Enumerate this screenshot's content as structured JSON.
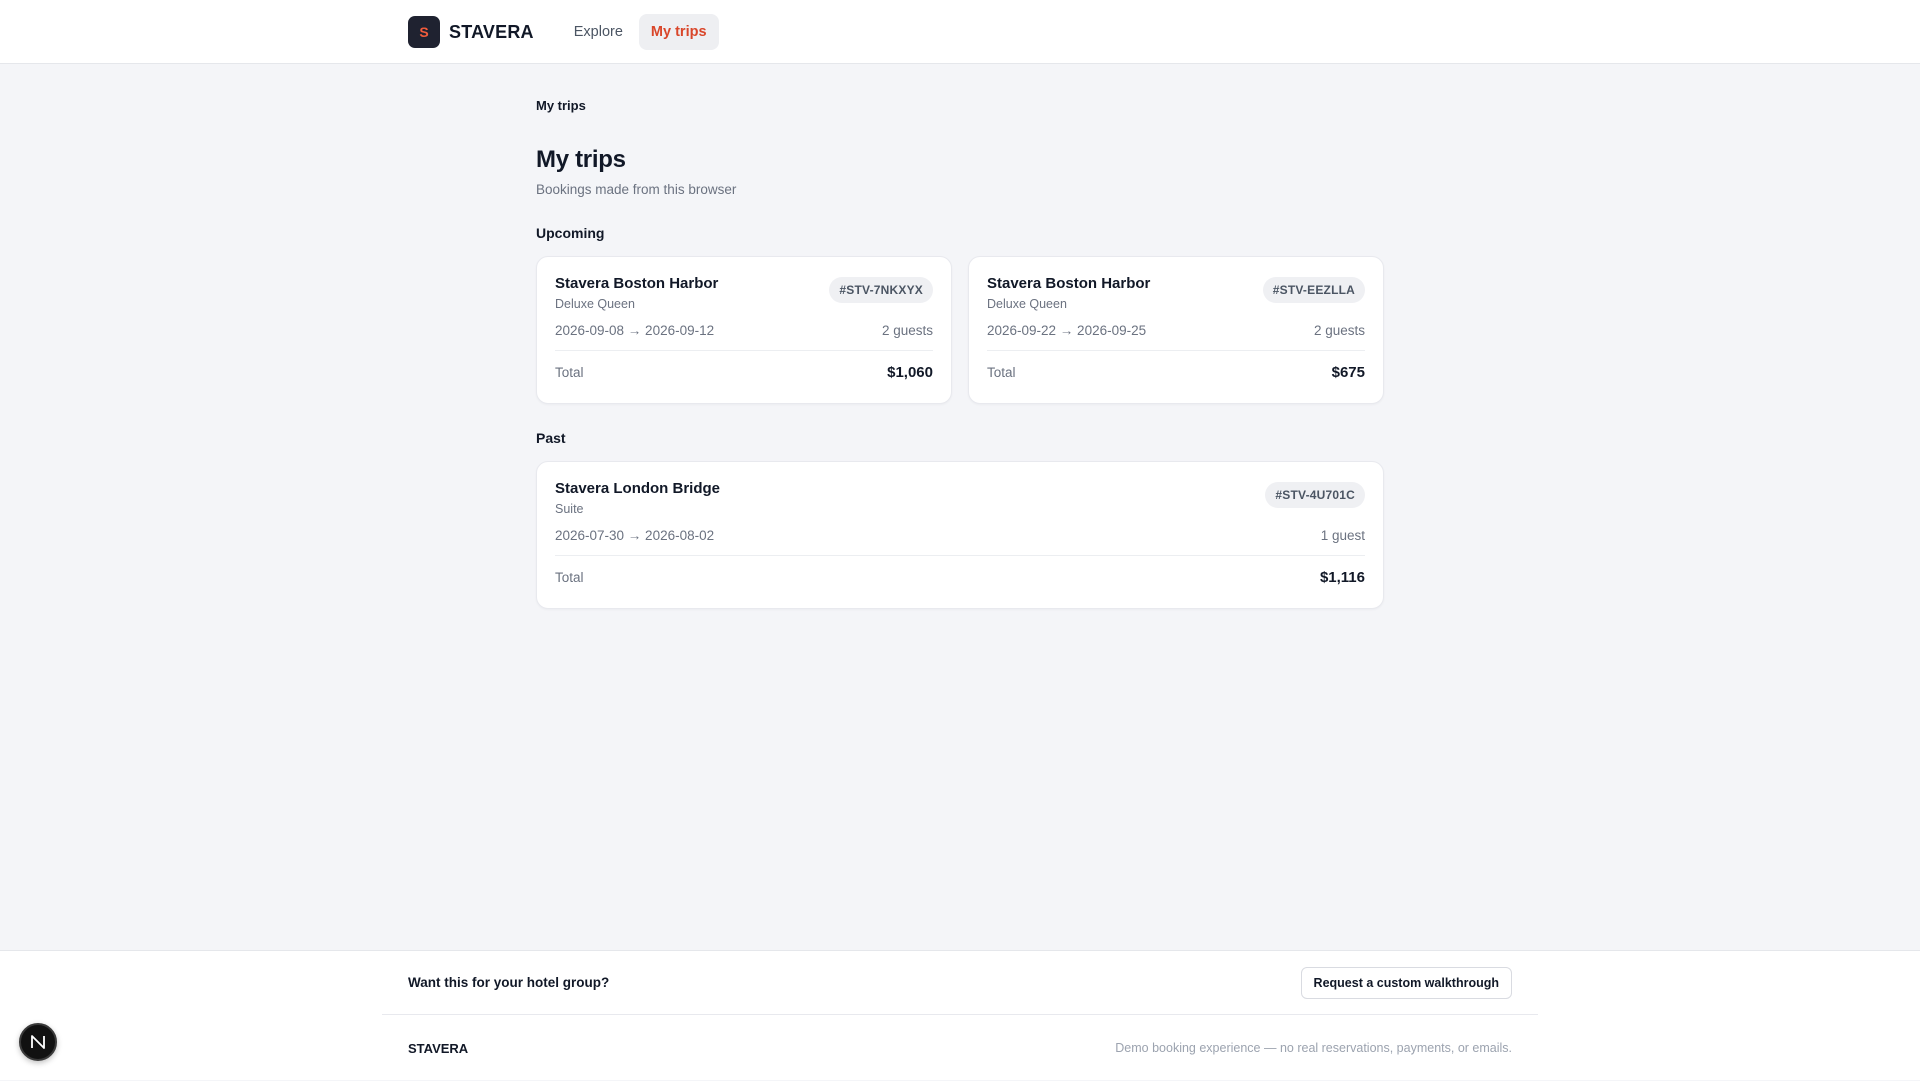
{
  "header": {
    "logo_letter": "S",
    "brand": "STAVERA",
    "nav": [
      {
        "label": "Explore",
        "active": false
      },
      {
        "label": "My trips",
        "active": true
      }
    ]
  },
  "page": {
    "breadcrumb": "My trips",
    "title": "My trips",
    "subtitle": "Bookings made from this browser"
  },
  "sections": {
    "upcoming": {
      "heading": "Upcoming",
      "trips": [
        {
          "hotel": "Stavera Boston Harbor",
          "room": "Deluxe Queen",
          "confirmation": "#STV-7NKXYX",
          "dates": "2026-09-08 → 2026-09-12",
          "guests": "2 guests",
          "total_label": "Total",
          "total": "$1,060"
        },
        {
          "hotel": "Stavera Boston Harbor",
          "room": "Deluxe Queen",
          "confirmation": "#STV-EEZLLA",
          "dates": "2026-09-22 → 2026-09-25",
          "guests": "2 guests",
          "total_label": "Total",
          "total": "$675"
        }
      ]
    },
    "past": {
      "heading": "Past",
      "trips": [
        {
          "hotel": "Stavera London Bridge",
          "room": "Suite",
          "confirmation": "#STV-4U701C",
          "dates": "2026-07-30 → 2026-08-02",
          "guests": "1 guest",
          "total_label": "Total",
          "total": "$1,116"
        }
      ]
    }
  },
  "footer": {
    "cta_text": "Want this for your hotel group?",
    "cta_button": "Request a custom walkthrough",
    "brand": "STAVERA",
    "note": "Demo booking experience — no real reservations, payments, or emails."
  },
  "colors": {
    "accent": "#d9462a",
    "logo_bg": "#1f2230",
    "page_bg": "#f4f5f8"
  },
  "icons": {
    "dev_badge": "nextjs-n-icon"
  }
}
